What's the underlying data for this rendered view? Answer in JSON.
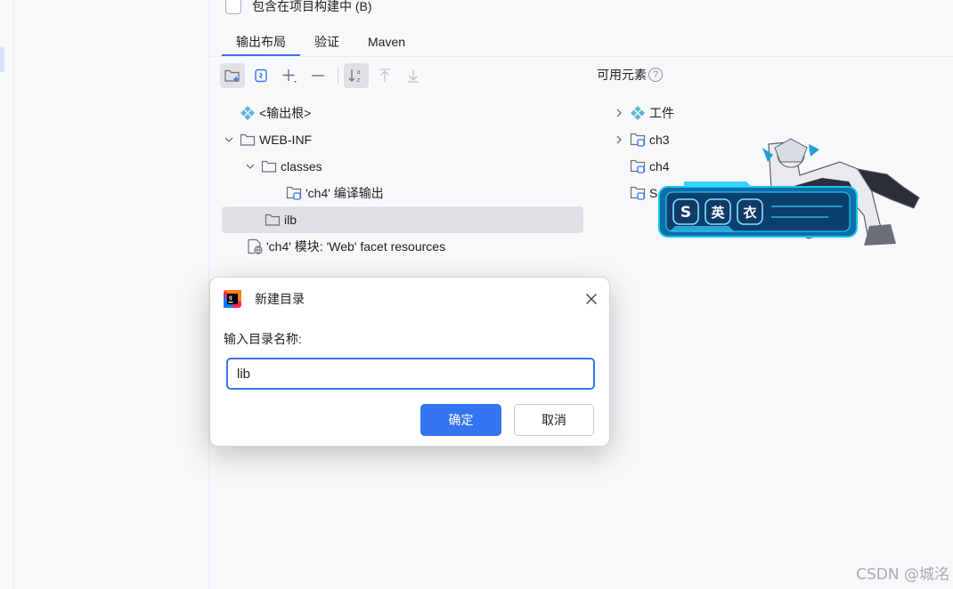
{
  "settings": {
    "include_in_build_label": "包含在项目构建中 (B)",
    "include_in_build_checked": false
  },
  "tabs": [
    {
      "label": "输出布局",
      "active": true
    },
    {
      "label": "验证",
      "active": false
    },
    {
      "label": "Maven",
      "active": false
    }
  ],
  "toolbar": {
    "icons": [
      "new-folder-icon",
      "archive-icon",
      "add-icon",
      "remove-icon",
      "sort-icon",
      "move-up-icon",
      "move-down-icon"
    ]
  },
  "output_tree": [
    {
      "label": "<输出根>",
      "icon": "output-root-icon",
      "chevron": "none"
    },
    {
      "label": "WEB-INF",
      "icon": "folder-icon",
      "chevron": "down"
    },
    {
      "label": "classes",
      "icon": "folder-icon",
      "chevron": "down"
    },
    {
      "label": "'ch4' 编译输出",
      "icon": "module-output-icon",
      "chevron": "none"
    },
    {
      "label": "ilb",
      "icon": "folder-icon",
      "chevron": "none",
      "selected": true
    },
    {
      "label": "'ch4' 模块: 'Web' facet resources",
      "icon": "web-facet-icon",
      "chevron": "none"
    }
  ],
  "available": {
    "title": "可用元素",
    "items": [
      {
        "label": "工件",
        "icon": "artifact-icon",
        "chevron": "right"
      },
      {
        "label": "ch3",
        "icon": "module-icon",
        "chevron": "right"
      },
      {
        "label": "ch4",
        "icon": "module-icon",
        "chevron": "none"
      },
      {
        "label": "S",
        "icon": "module-icon",
        "chevron": "none"
      }
    ]
  },
  "decal": {
    "buttons": [
      "S",
      "英",
      "衣"
    ]
  },
  "dialog": {
    "title": "新建目录",
    "prompt": "输入目录名称:",
    "input_value": "lib",
    "ok_label": "确定",
    "cancel_label": "取消"
  },
  "watermark": "CSDN @城洺",
  "colors": {
    "accent": "#3574f0",
    "background": "#f7f8fa",
    "selection": "#dfe1e5"
  }
}
